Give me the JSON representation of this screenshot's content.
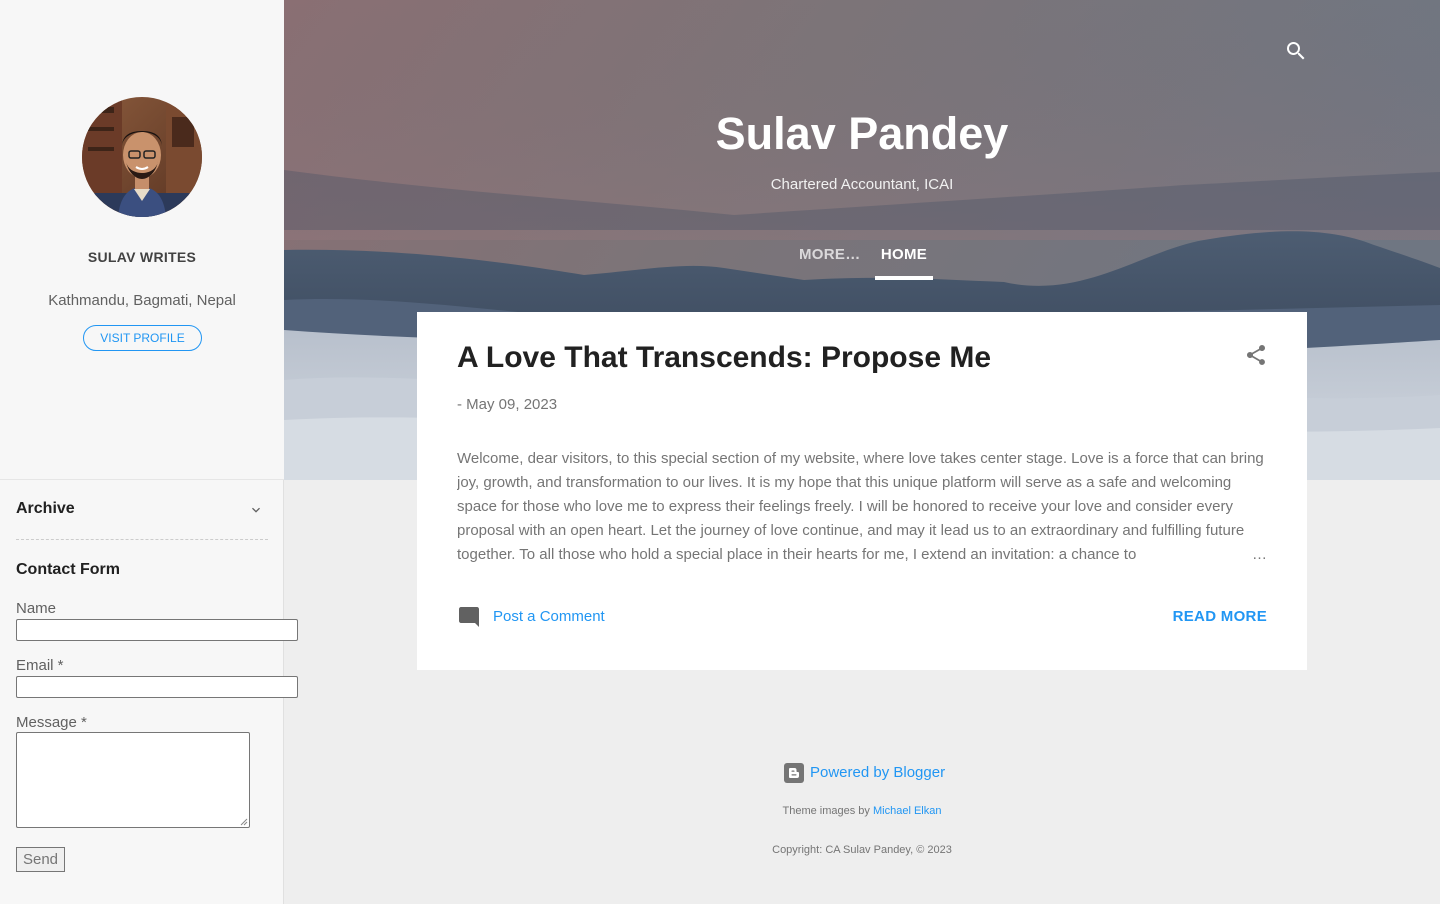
{
  "sidebar": {
    "profile": {
      "name": "SULAV WRITES",
      "location": "Kathmandu, Bagmati, Nepal",
      "visit_label": "VISIT PROFILE"
    },
    "archive": {
      "title": "Archive"
    },
    "contact_form": {
      "title": "Contact Form",
      "name_label": "Name",
      "email_label": "Email *",
      "message_label": "Message *",
      "send_label": "Send"
    }
  },
  "header": {
    "title": "Sulav Pandey",
    "description": "Chartered Accountant, ICAI",
    "nav": {
      "more": "MORE…",
      "home": "HOME"
    }
  },
  "post": {
    "title": "A Love That Transcends: Propose Me",
    "date_prefix": "-",
    "date": "May 09, 2023",
    "snippet": "Welcome, dear visitors, to this special section of my website, where love takes center stage. Love is a force that can bring joy, growth, and transformation to our lives. It is my hope that this unique platform will serve as a safe and welcoming space for those who love me to express their feelings freely. I will be honored to receive your love and consider every proposal with an open heart. Let the journey of love continue, and may it lead us to an extraordinary and fulfilling future together. To all those who hold a special place in their hearts for me, I extend an invitation: a chance to",
    "ellipsis": "…",
    "comment_label": "Post a Comment",
    "read_more": "READ MORE"
  },
  "footer": {
    "powered_by": "Powered by Blogger",
    "theme_prefix": "Theme images by",
    "theme_author": "Michael Elkan",
    "copyright": "Copyright: CA Sulav Pandey, © 2023"
  },
  "icons": {
    "search": "search-icon",
    "share": "share-icon",
    "comment": "comment-icon",
    "chevron": "chevron-down-icon",
    "blogger": "blogger-icon"
  },
  "colors": {
    "accent": "#2196f3",
    "card": "#ffffff",
    "page_bg": "#eeeeee",
    "sidebar_bg": "#f7f7f7"
  }
}
